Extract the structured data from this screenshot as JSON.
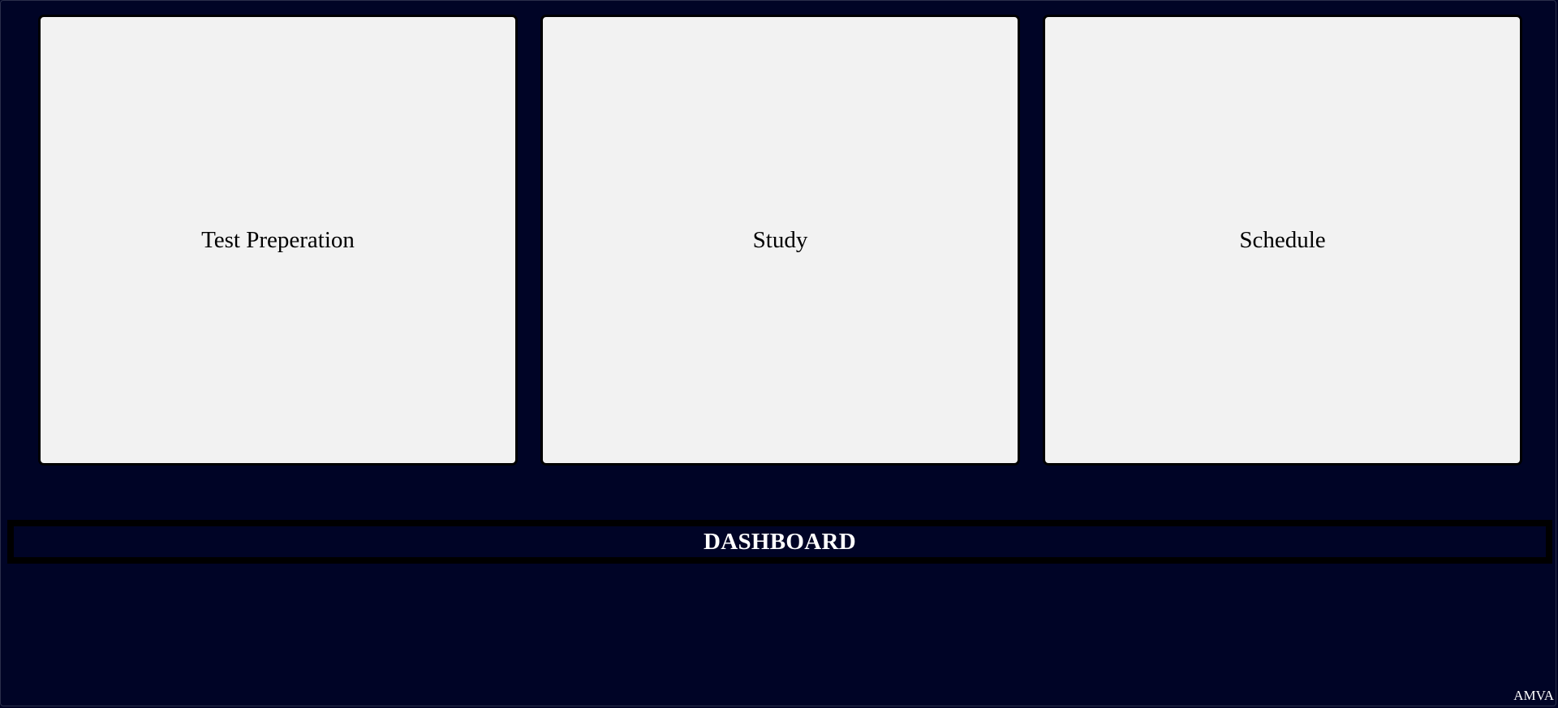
{
  "cards": [
    {
      "label": "Test Preperation"
    },
    {
      "label": "Study"
    },
    {
      "label": "Schedule"
    }
  ],
  "dashboard": {
    "title": "DASHBOARD"
  },
  "footer": {
    "brand": "AMVA"
  },
  "colors": {
    "background": "#000426",
    "card": "#f2f2f2",
    "border": "#000000",
    "title_text": "#ffffff"
  }
}
